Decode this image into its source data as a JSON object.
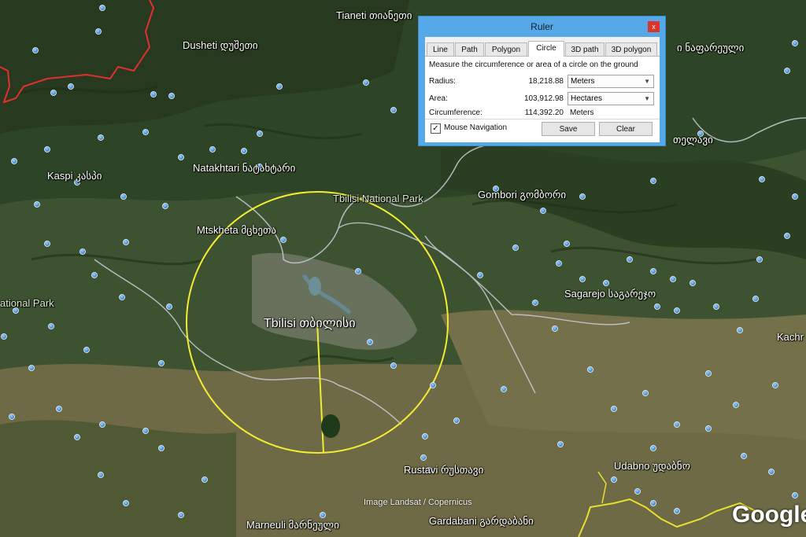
{
  "map": {
    "places": [
      {
        "key": "tianeti",
        "text": "Tianeti თიანეთი"
      },
      {
        "key": "dusheti",
        "text": "Dusheti დუშეთი"
      },
      {
        "key": "kaspi",
        "text": "Kaspi კასპი"
      },
      {
        "key": "natakhtari",
        "text": "Natakhtari ნატახტარი"
      },
      {
        "key": "mtskheta",
        "text": "Mtskheta მცხეთა"
      },
      {
        "key": "tbilisi",
        "text": "Tbilisi თბილისი"
      },
      {
        "key": "gombori",
        "text": "Gombori გომბორი"
      },
      {
        "key": "sagarejo",
        "text": "Sagarejo საგარეჯო"
      },
      {
        "key": "rustavi",
        "text": "Rustavi რუსთავი"
      },
      {
        "key": "udabno",
        "text": "Udabno უდაბნო"
      },
      {
        "key": "marneuli",
        "text": "Marneuli მარნეული"
      },
      {
        "key": "gardabani",
        "text": "Gardabani გარდაბანი"
      },
      {
        "key": "kachr",
        "text": "Kachr"
      },
      {
        "key": "east1",
        "text": "ი ნაფარეული"
      },
      {
        "key": "east2",
        "text": "თელავი"
      }
    ],
    "parks": [
      {
        "key": "tbilisi_park",
        "text": "Tbilisi National Park"
      },
      {
        "key": "west_park",
        "text": "ational Park"
      }
    ],
    "imagery_credit": "Image Landsat / Copernicus",
    "logo": "Google",
    "colors": {
      "ruler_circle": "#f2ec35",
      "border_red": "#e23030",
      "border_yellow": "#e8e030",
      "admin_line": "#c9ccd6",
      "pin": "#3d8ee0"
    }
  },
  "ruler": {
    "title": "Ruler",
    "close_label": "x",
    "tabs": [
      {
        "label": "Line",
        "active": false
      },
      {
        "label": "Path",
        "active": false
      },
      {
        "label": "Polygon",
        "active": false
      },
      {
        "label": "Circle",
        "active": true
      },
      {
        "label": "3D path",
        "active": false
      },
      {
        "label": "3D polygon",
        "active": false
      }
    ],
    "description": "Measure the circumference or area of a circle on the ground",
    "radius_label": "Radius:",
    "radius_value": "18,218.88",
    "radius_unit": "Meters",
    "area_label": "Area:",
    "area_value": "103,912.98",
    "area_unit": "Hectares",
    "circumference_label": "Circumference:",
    "circumference_value": "114,392.20",
    "circumference_unit": "Meters",
    "mouse_nav_label": "Mouse Navigation",
    "mouse_nav_checked": "✓",
    "save_label": "Save",
    "clear_label": "Clear"
  }
}
